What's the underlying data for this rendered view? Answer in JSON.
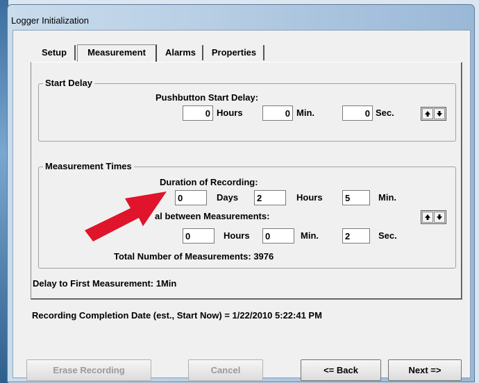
{
  "window": {
    "title": "Logger Initialization"
  },
  "tabs": [
    {
      "label": "Setup"
    },
    {
      "label": "Measurement"
    },
    {
      "label": "Alarms"
    },
    {
      "label": "Properties"
    }
  ],
  "start_delay": {
    "legend": "Start Delay",
    "heading": "Pushbutton Start Delay:",
    "hours_value": "0",
    "hours_unit": "Hours",
    "min_value": "0",
    "min_unit": "Min.",
    "sec_value": "0",
    "sec_unit": "Sec."
  },
  "measurement_times": {
    "legend": "Measurement Times",
    "duration_heading": "Duration of Recording:",
    "days_value": "0",
    "days_unit": "Days",
    "hours_value": "2",
    "hours_unit": "Hours",
    "min_value": "5",
    "min_unit": "Min.",
    "interval_heading": "al between Measurements:",
    "int_hours_value": "0",
    "int_hours_unit": "Hours",
    "int_min_value": "0",
    "int_min_unit": "Min.",
    "int_sec_value": "2",
    "int_sec_unit": "Sec.",
    "total_label": "Total Number of Measurements:",
    "total_value": "3976"
  },
  "info": {
    "delay_first": "Delay to First Measurement: 1Min",
    "completion": "Recording Completion Date (est., Start Now) = 1/22/2010 5:22:41 PM"
  },
  "buttons": {
    "erase": "Erase Recording",
    "cancel": "Cancel",
    "back": "<= Back",
    "next": "Next =>"
  },
  "colors": {
    "arrow": "#e0142a",
    "field_bg": "#ffffff",
    "dialog_bg": "#f0f0f0"
  },
  "icons": [
    "up-arrow-icon",
    "down-arrow-icon",
    "red-annotation-arrow"
  ]
}
